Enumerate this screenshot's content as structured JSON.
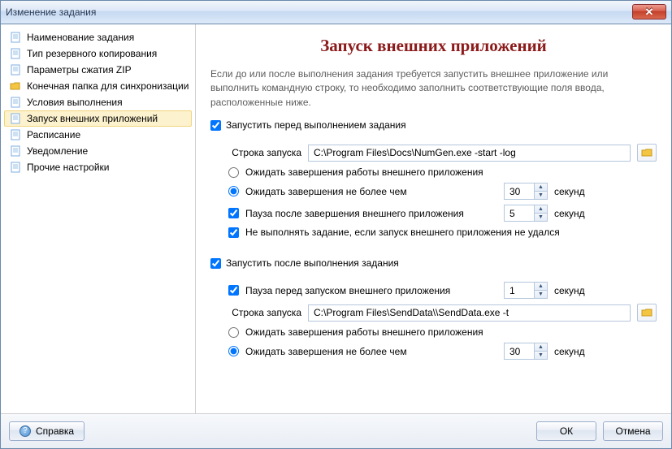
{
  "window": {
    "title": "Изменение задания"
  },
  "sidebar": {
    "items": [
      {
        "label": "Наименование задания"
      },
      {
        "label": "Тип резервного копирования"
      },
      {
        "label": "Параметры сжатия ZIP"
      },
      {
        "label": "Конечная папка для синхронизации"
      },
      {
        "label": "Условия выполнения"
      },
      {
        "label": "Запуск внешних приложений"
      },
      {
        "label": "Расписание"
      },
      {
        "label": "Уведомление"
      },
      {
        "label": "Прочие настройки"
      }
    ],
    "selected_index": 5
  },
  "main": {
    "title": "Запуск внешних приложений",
    "description": "Если до или после выполнения задания требуется запустить внешнее приложение или выполнить командную строку, то необходимо заполнить соответствующие поля ввода, расположенные ниже.",
    "before": {
      "enable_label": "Запустить перед выполнением задания",
      "enable_checked": true,
      "cmd_label": "Строка запуска",
      "cmd_value": "C:\\Program Files\\Docs\\NumGen.exe -start -log",
      "wait_finish_label": "Ожидать завершения работы внешнего приложения",
      "wait_timeout_label": "Ожидать завершения не более чем",
      "wait_timeout_value": "30",
      "wait_timeout_unit": "секунд",
      "wait_mode_selected": "timeout",
      "pause_after_label": "Пауза после завершения внешнего приложения",
      "pause_after_checked": true,
      "pause_after_value": "5",
      "pause_after_unit": "секунд",
      "abort_label": "Не выполнять задание, если запуск внешнего приложения не удался",
      "abort_checked": true
    },
    "after": {
      "enable_label": "Запустить после выполнения задания",
      "enable_checked": true,
      "pause_before_label": "Пауза перед запуском внешнего приложения",
      "pause_before_checked": true,
      "pause_before_value": "1",
      "pause_before_unit": "секунд",
      "cmd_label": "Строка запуска",
      "cmd_value": "C:\\Program Files\\SendData\\\\SendData.exe -t",
      "wait_finish_label": "Ожидать завершения работы внешнего приложения",
      "wait_timeout_label": "Ожидать завершения не более чем",
      "wait_timeout_value": "30",
      "wait_timeout_unit": "секунд",
      "wait_mode_selected": "timeout"
    }
  },
  "footer": {
    "help_label": "Справка",
    "ok_label": "ОК",
    "cancel_label": "Отмена"
  }
}
